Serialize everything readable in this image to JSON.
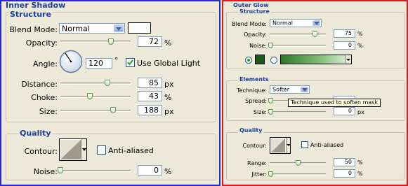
{
  "inner_shadow": {
    "title": "Inner Shadow",
    "structure": {
      "legend": "Structure",
      "blend_mode_label": "Blend Mode:",
      "blend_mode_value": "Normal",
      "color": "#ffffff",
      "opacity_label": "Opacity:",
      "opacity_value": "72",
      "opacity_unit": "%",
      "opacity_level": 0.72,
      "angle_label": "Angle:",
      "angle_value": "120",
      "angle_unit": "°",
      "use_global_light_label": "Use Global Light",
      "use_global_light_checked": true,
      "distance_label": "Distance:",
      "distance_value": "85",
      "distance_unit": "px",
      "choke_label": "Choke:",
      "choke_value": "43",
      "choke_unit": "%",
      "size_label": "Size:",
      "size_value": "188",
      "size_unit": "px"
    },
    "quality": {
      "legend": "Quality",
      "contour_label": "Contour:",
      "anti_aliased_label": "Anti-aliased",
      "anti_aliased_checked": false,
      "noise_label": "Noise:",
      "noise_value": "0",
      "noise_unit": "%"
    }
  },
  "outer_glow": {
    "title": "Outer Glow",
    "structure": {
      "legend": "Structure",
      "blend_mode_label": "Blend Mode:",
      "blend_mode_value": "Normal",
      "opacity_label": "Opacity:",
      "opacity_value": "75",
      "opacity_unit": "%",
      "noise_label": "Noise:",
      "noise_value": "0",
      "noise_unit": "%",
      "color": "#1e5a14",
      "gradient_color": "#2c7a28"
    },
    "elements": {
      "legend": "Elements",
      "technique_label": "Technique:",
      "technique_value": "Softer",
      "spread_label": "Spread:",
      "size_label": "Size:",
      "size_value": "0",
      "size_unit": "px",
      "tooltip": "Technique used to soften mask"
    },
    "quality": {
      "legend": "Quality",
      "contour_label": "Contour:",
      "anti_aliased_label": "Anti-aliased",
      "anti_aliased_checked": false,
      "range_label": "Range:",
      "range_value": "50",
      "range_unit": "%",
      "jitter_label": "Jitter:",
      "jitter_value": "0",
      "jitter_unit": "%"
    }
  },
  "accent_colors": {
    "left_border": "#2929c8",
    "right_border": "#d22020",
    "heading": "#1c3e9e"
  }
}
